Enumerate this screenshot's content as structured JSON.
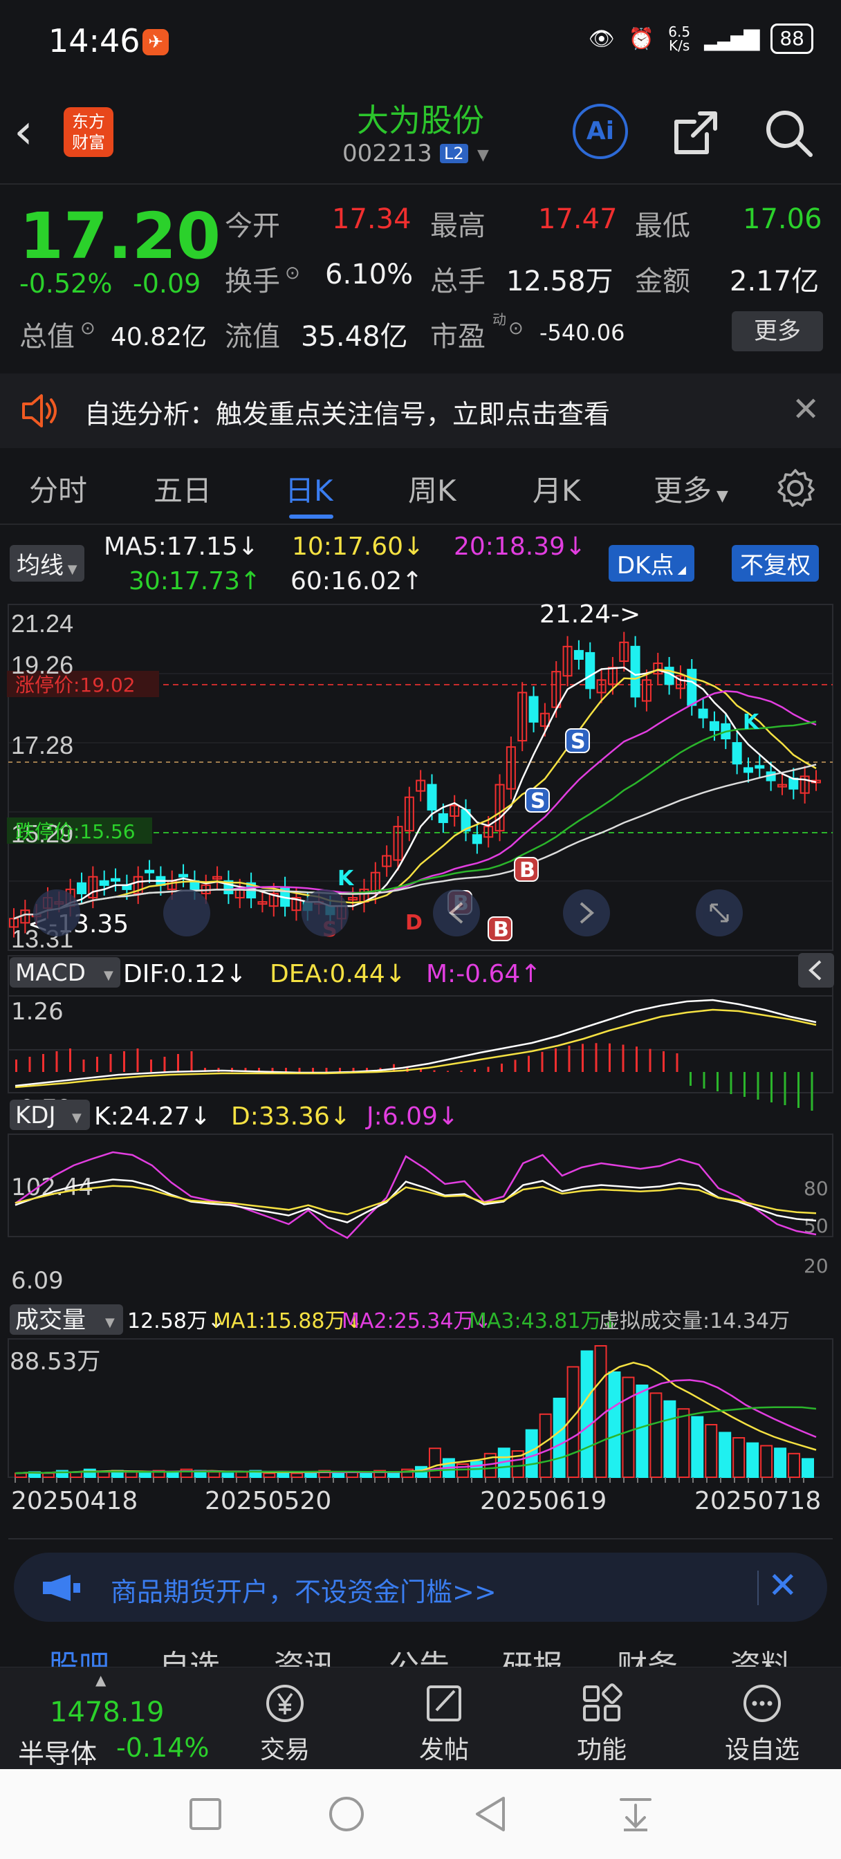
{
  "status_bar": {
    "time": "14:46",
    "net_speed_top": "6.5",
    "net_speed_bottom": "K/s",
    "battery": "88"
  },
  "header": {
    "logo_line1": "东方",
    "logo_line2": "财富",
    "stock_name": "大为股份",
    "stock_code": "002213",
    "badge": "L2",
    "ai": "Ai"
  },
  "quote": {
    "price": "17.20",
    "change_pct": "-0.52%",
    "change_val": "-0.09",
    "open_label": "今开",
    "open": "17.34",
    "high_label": "最高",
    "high": "17.47",
    "low_label": "最低",
    "low": "17.06",
    "turnover_label": "换手",
    "turnover": "6.10%",
    "volume_label": "总手",
    "volume": "12.58万",
    "amount_label": "金额",
    "amount": "2.17亿",
    "mktcap_label": "总值",
    "mktcap": "40.82亿",
    "float_label": "流值",
    "float": "35.48亿",
    "pe_label": "市盈",
    "pe_sup": "动",
    "pe": "-540.06",
    "more": "更多"
  },
  "alert": {
    "text": "自选分析：触发重点关注信号，立即点击查看"
  },
  "tabs": [
    "分时",
    "五日",
    "日K",
    "周K",
    "月K",
    "更多"
  ],
  "active_tab": "日K",
  "ma_legend": {
    "selector": "均线",
    "ma5": "MA5:17.15↓",
    "ma10": "10:17.60↓",
    "ma20": "20:18.39↓",
    "ma30": "30:17.73↑",
    "ma60": "60:16.02↑",
    "dk": "DK点",
    "adj": "不复权"
  },
  "kline": {
    "y_labels": [
      "21.24",
      "19.26",
      "17.28",
      "15.29",
      "13.31"
    ],
    "limit_up": "涨停价:19.02",
    "limit_down": "跌停价:15.56",
    "max_annot": "21.24->",
    "min_annot": "<-13.35",
    "markers": {
      "s": "S",
      "b": "B",
      "k": "K",
      "d": "D"
    }
  },
  "macd": {
    "selector": "MACD",
    "dif": "DIF:0.12↓",
    "dea": "DEA:0.44↓",
    "m": "M:-0.64↑",
    "y_top": "1.26",
    "y_bottom": "-0.79"
  },
  "kdj": {
    "selector": "KDJ",
    "k": "K:24.27↓",
    "d": "D:33.36↓",
    "j": "J:6.09↓",
    "y_top": "102.44",
    "y_bottom": "6.09",
    "r80": "80",
    "r50": "50",
    "r20": "20"
  },
  "volume": {
    "selector": "成交量",
    "vol": "12.58万↓",
    "ma1": "MA1:15.88万↓",
    "ma2": "MA2:25.34万↓",
    "ma3": "MA3:43.81万↓",
    "virtual": "虚拟成交量:14.34万",
    "y_top": "88.53万"
  },
  "dates": [
    "20250418",
    "20250520",
    "20250619",
    "20250718"
  ],
  "ad": {
    "text": "商品期货开户，不设资金门槛>>"
  },
  "peek_tabs": [
    "股吧",
    "自选",
    "资讯",
    "公告",
    "研报",
    "财务",
    "资料"
  ],
  "bottom": {
    "index_value": "1478.19",
    "index_name": "半导体",
    "index_change": "-0.14%",
    "trade": "交易",
    "post": "发帖",
    "function": "功能",
    "watch": "设自选"
  },
  "chart_data": {
    "type": "candlestick",
    "title": "大为股份 日K",
    "dates": [
      "20250418",
      "20250520",
      "20250619",
      "20250718"
    ],
    "ylim": [
      13.31,
      21.24
    ],
    "series": [
      {
        "name": "MA5",
        "last": 17.15
      },
      {
        "name": "MA10",
        "last": 17.6
      },
      {
        "name": "MA20",
        "last": 18.39
      },
      {
        "name": "MA30",
        "last": 17.73
      },
      {
        "name": "MA60",
        "last": 16.02
      }
    ],
    "period_high": 21.24,
    "period_low": 13.35,
    "last_close": 17.2,
    "limit_up": 19.02,
    "limit_down": 15.56,
    "colors": {
      "up": "#f02f2f",
      "down": "#1ff0f0",
      "ma5": "#ffffff",
      "ma10": "#f5e142",
      "ma20": "#e23ee0",
      "ma30": "#2bb52b",
      "ma60": "#dddddd"
    }
  }
}
